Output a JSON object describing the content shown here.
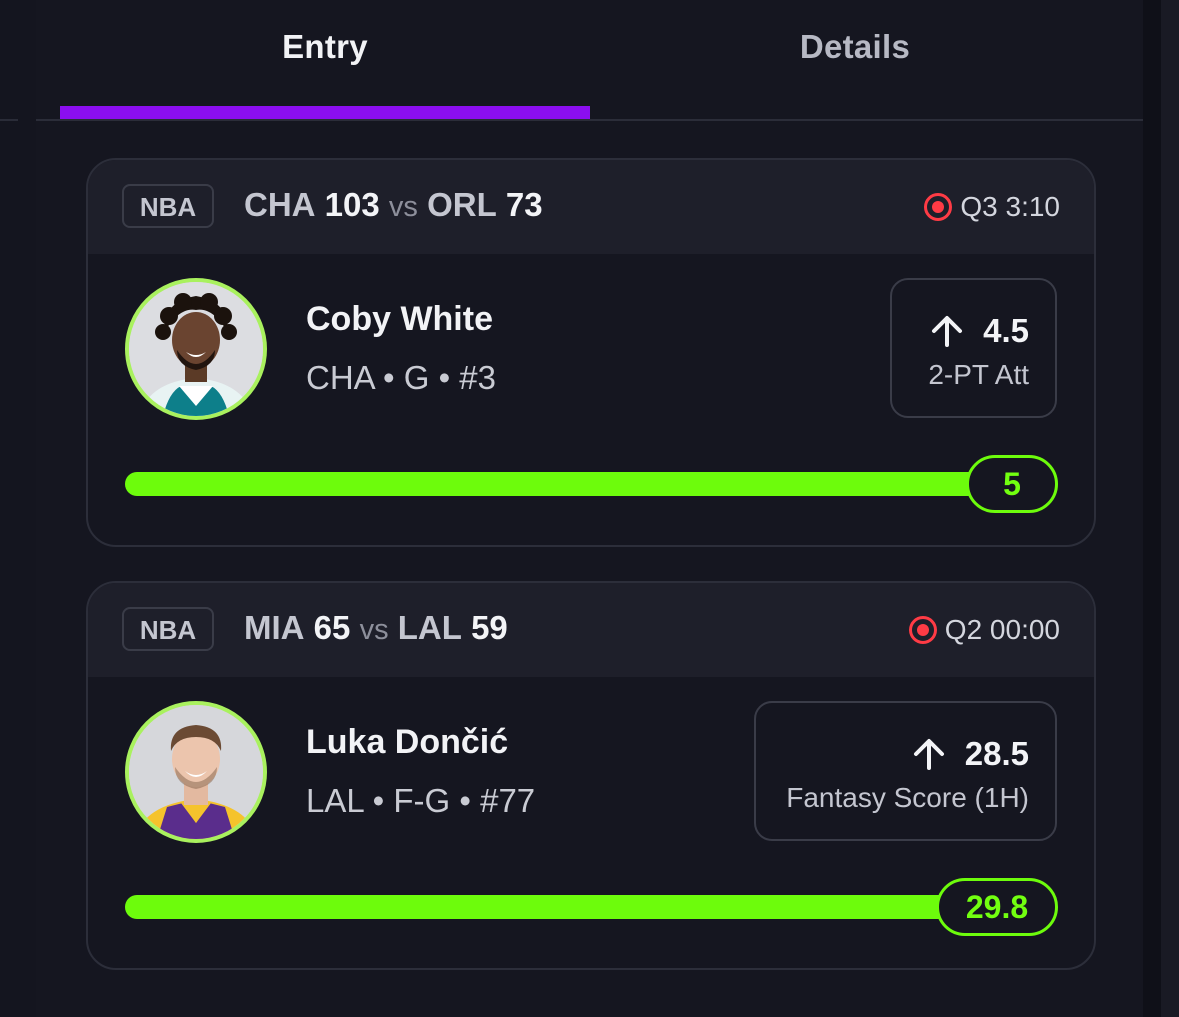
{
  "tabs": [
    {
      "label": "Entry",
      "active": true
    },
    {
      "label": "Details",
      "active": false
    }
  ],
  "colors": {
    "accent_tab": "#8b0ef0",
    "progress": "#6dfc0c",
    "avatar_ring": "#a9f15e",
    "live": "#ff3b45"
  },
  "picks": [
    {
      "league": "NBA",
      "home_team": "CHA",
      "home_score": "103",
      "vs_label": "vs",
      "away_team": "ORL",
      "away_score": "73",
      "status_icon": "live-record-icon",
      "status": "Q3 3:10",
      "player_name": "Coby White",
      "player_info": "CHA • G • #3",
      "direction_icon": "arrow-up-icon",
      "line": "4.5",
      "stat": "2-PT Att",
      "current": "5",
      "progress_fraction": 1.0
    },
    {
      "league": "NBA",
      "home_team": "MIA",
      "home_score": "65",
      "vs_label": "vs",
      "away_team": "LAL",
      "away_score": "59",
      "status_icon": "live-record-icon",
      "status": "Q2 00:00",
      "player_name": "Luka Dončić",
      "player_info": "LAL • F-G • #77",
      "direction_icon": "arrow-up-icon",
      "line": "28.5",
      "stat": "Fantasy Score (1H)",
      "current": "29.8",
      "progress_fraction": 1.0
    }
  ]
}
